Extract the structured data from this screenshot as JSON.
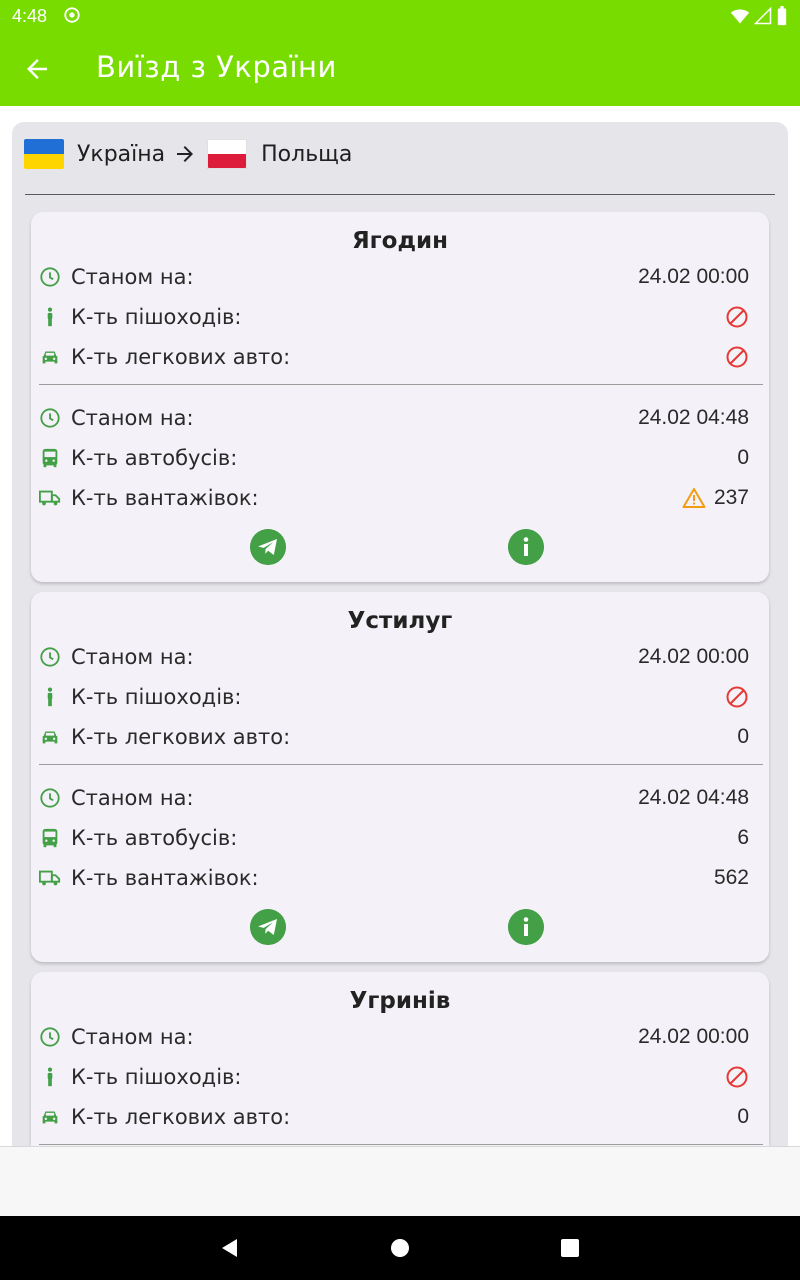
{
  "status_bar": {
    "time": "4:48",
    "icons": [
      "sync-icon",
      "wifi-icon",
      "signal-icon",
      "battery-icon"
    ]
  },
  "app_bar": {
    "title": "Виїзд з України",
    "back_icon": "arrow-left-icon"
  },
  "route": {
    "from": "Україна",
    "to": "Польща",
    "from_flag": "ukraine-flag",
    "to_flag": "poland-flag"
  },
  "checkpoints": [
    {
      "name": "Ягодин",
      "section1": {
        "as_of_label": "Станом на:",
        "as_of_value": "24.02 00:00",
        "pedestrians_label": "К-ть пішоходів:",
        "pedestrians_value": "",
        "pedestrians_status": "not-allowed",
        "cars_label": "К-ть легкових авто:",
        "cars_value": "",
        "cars_status": "not-allowed"
      },
      "section2": {
        "as_of_label": "Станом на:",
        "as_of_value": "24.02 04:48",
        "buses_label": "К-ть автобусів:",
        "buses_value": "0",
        "trucks_label": "К-ть вантажівок:",
        "trucks_value": "237",
        "trucks_status": "warning"
      }
    },
    {
      "name": "Устилуг",
      "section1": {
        "as_of_label": "Станом на:",
        "as_of_value": "24.02 00:00",
        "pedestrians_label": "К-ть пішоходів:",
        "pedestrians_value": "",
        "pedestrians_status": "not-allowed",
        "cars_label": "К-ть легкових авто:",
        "cars_value": "0"
      },
      "section2": {
        "as_of_label": "Станом на:",
        "as_of_value": "24.02 04:48",
        "buses_label": "К-ть автобусів:",
        "buses_value": "6",
        "trucks_label": "К-ть вантажівок:",
        "trucks_value": "562"
      }
    },
    {
      "name": "Угринів",
      "section1": {
        "as_of_label": "Станом на:",
        "as_of_value": "24.02 00:00",
        "pedestrians_label": "К-ть пішоходів:",
        "pedestrians_value": "",
        "pedestrians_status": "not-allowed",
        "cars_label": "К-ть легкових авто:",
        "cars_value": "0"
      }
    }
  ],
  "colors": {
    "accent": "#78dc00",
    "icon_green": "#43a047",
    "not_allowed_red": "#e53935",
    "warning_orange": "#f39c12"
  }
}
